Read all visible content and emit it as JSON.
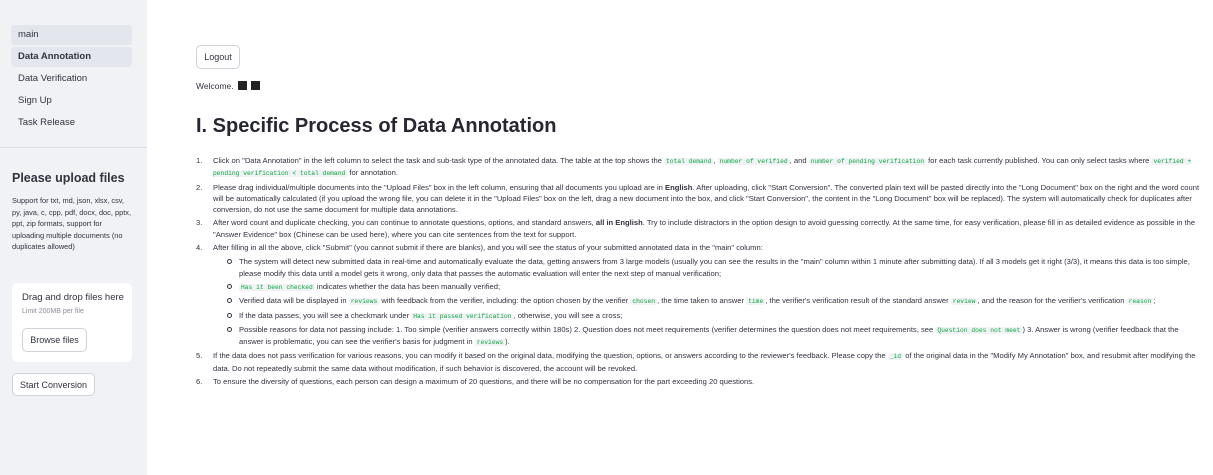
{
  "sidebar": {
    "nav": [
      {
        "label": "main",
        "state": "first"
      },
      {
        "label": "Data Annotation",
        "state": "active"
      },
      {
        "label": "Data Verification",
        "state": ""
      },
      {
        "label": "Sign Up",
        "state": ""
      },
      {
        "label": "Task Release",
        "state": ""
      }
    ],
    "upload_title": "Please upload files",
    "upload_help": "Support for txt, md, json, xlsx, csv, py, java, c, cpp, pdf, docx, doc, pptx, ppt, zip formats, support for uploading multiple documents (no duplicates allowed)",
    "dropzone": {
      "title": "Drag and drop files here",
      "limit": "Limit 200MB per file",
      "browse_label": "Browse files"
    },
    "convert_label": "Start Conversion"
  },
  "main": {
    "logout_label": "Logout",
    "welcome": "Welcome.",
    "title": "I. Specific Process of Data Annotation",
    "items": [
      {
        "n": "1.",
        "parts": [
          {
            "t": "Click on \"Data Annotation\" in the left column to select the task and sub-task type of the annotated data. The table at the top shows the "
          },
          {
            "c": "total demand"
          },
          {
            "t": ", "
          },
          {
            "c": "number of verified"
          },
          {
            "t": ", and "
          },
          {
            "c": "number of pending verification"
          },
          {
            "t": " for each task currently published. You can only select tasks where "
          },
          {
            "c": "verified + pending verification < total demand"
          },
          {
            "t": " for annotation."
          }
        ]
      },
      {
        "n": "2.",
        "parts": [
          {
            "t": "Please drag individual/multiple documents into the \"Upload Files\" box in the left column, ensuring that all documents you upload are in "
          },
          {
            "b": "English"
          },
          {
            "t": ". After uploading, click \"Start Conversion\". The converted plain text will be pasted directly into the \"Long Document\" box on the right and the word count will be automatically calculated (if you upload the wrong file, you can delete it in the \"Upload Files\" box on the left, drag a new document into the box, and click \"Start Conversion\", the content in the \"Long Document\" box will be replaced). The system will automatically check for duplicates after conversion, do not use the same document for multiple data annotations."
          }
        ]
      },
      {
        "n": "3.",
        "parts": [
          {
            "t": "After word count and duplicate checking, you can continue to annotate questions, options, and standard answers, "
          },
          {
            "b": "all in English"
          },
          {
            "t": ". Try to include distractors in the option design to avoid guessing correctly. At the same time, for easy verification, please fill in as detailed evidence as possible in the \"Answer Evidence\" box (Chinese can be used here), where you can cite sentences from the text for support."
          }
        ]
      },
      {
        "n": "4.",
        "parts": [
          {
            "t": "After filling in all the above, click \"Submit\" (you cannot submit if there are blanks), and you will see the status of your submitted annotated data in the \"main\" column:"
          }
        ],
        "subs": [
          [
            {
              "t": "The system will detect new submitted data in real-time and automatically evaluate the data, getting answers from 3 large models (usually you can see the results in the \"main\" column within 1 minute after submitting data). If all 3 models get it right (3/3), it means this data is too simple, please modify this data until a model gets it wrong, only data that passes the automatic evaluation will enter the next step of manual verification;"
            }
          ],
          [
            {
              "c": "Has it been checked"
            },
            {
              "t": " indicates whether the data has been manually verified;"
            }
          ],
          [
            {
              "t": "Verified data will be displayed in "
            },
            {
              "c": "reviews"
            },
            {
              "t": " with feedback from the verifier, including: the option chosen by the verifier "
            },
            {
              "c": "chosen"
            },
            {
              "t": ", the time taken to answer "
            },
            {
              "c": "time"
            },
            {
              "t": ", the verifier's verification result of the standard answer "
            },
            {
              "c": "review"
            },
            {
              "t": ", and the reason for the verifier's verification "
            },
            {
              "c": "reason"
            },
            {
              "t": ";"
            }
          ],
          [
            {
              "t": "If the data passes, you will see a checkmark under "
            },
            {
              "c": "Has it passed verification"
            },
            {
              "t": ", otherwise, you will see a cross;"
            }
          ],
          [
            {
              "t": "Possible reasons for data not passing include: 1. Too simple (verifier answers correctly within 180s) 2. Question does not meet requirements (verifier determines the question does not meet requirements, see "
            },
            {
              "c": "Question does not meet"
            },
            {
              "t": ") 3. Answer is wrong (verifier feedback that the answer is problematic, you can see the verifier's basis for judgment in "
            },
            {
              "c": "reviews"
            },
            {
              "t": ")."
            }
          ]
        ]
      },
      {
        "n": "5.",
        "parts": [
          {
            "t": "If the data does not pass verification for various reasons, you can modify it based on the original data, modifying the question, options, or answers according to the reviewer's feedback. Please copy the "
          },
          {
            "c": "_id"
          },
          {
            "t": " of the original data in the \"Modify My Annotation\" box, and resubmit after modifying the data. Do not repeatedly submit the same data without modification, if such behavior is discovered, the account will be revoked."
          }
        ]
      },
      {
        "n": "6.",
        "parts": [
          {
            "t": "To ensure the diversity of questions, each person can design a maximum of 20 questions, and there will be no compensation for the part exceeding 20 questions."
          }
        ]
      }
    ]
  }
}
